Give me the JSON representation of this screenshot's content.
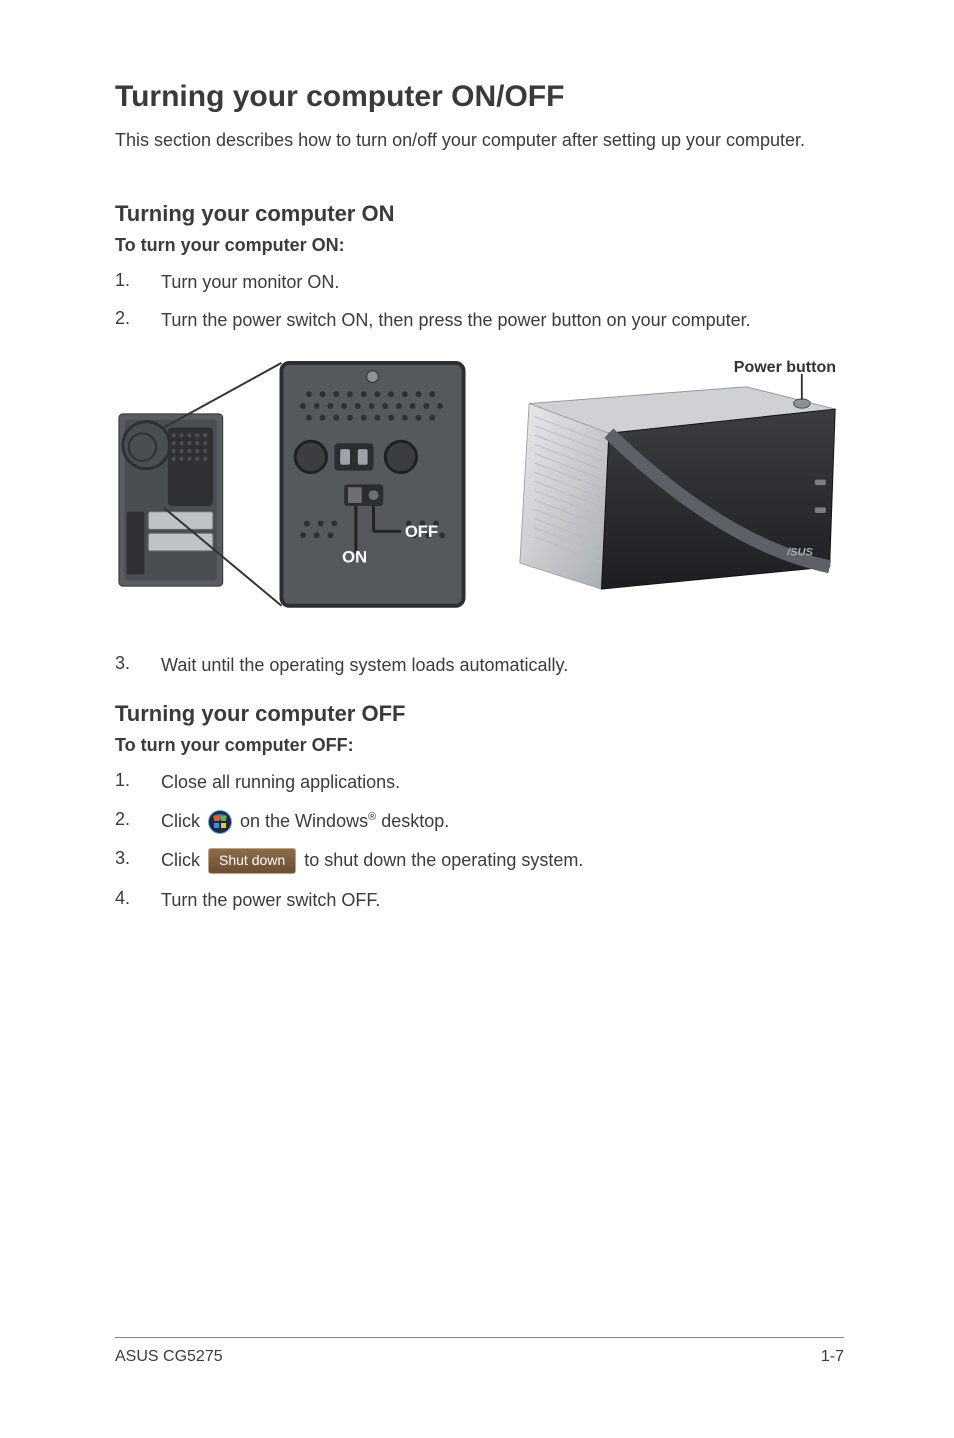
{
  "title": "Turning your computer ON/OFF",
  "intro": "This section describes how to turn on/off your computer after setting up your computer.",
  "on_section": {
    "heading": "Turning your computer ON",
    "instruction": "To turn your computer ON:",
    "steps": [
      "Turn your monitor ON.",
      "Turn the power switch ON, then press the power button on your computer."
    ],
    "step3": "Wait until the operating system loads automatically."
  },
  "off_section": {
    "heading": "Turning your computer OFF",
    "instruction": "To turn your computer OFF:",
    "steps": {
      "s1": "Close all running applications.",
      "s2_a": "Click ",
      "s2_b": " on the Windows",
      "s2_c": " desktop.",
      "s3_a": "Click ",
      "s3_b": " to shut down the operating system.",
      "s4": "Turn the power switch OFF."
    }
  },
  "labels": {
    "power_button": "Power button",
    "on": "ON",
    "off": "OFF",
    "shutdown": "Shut down",
    "reg": "®"
  },
  "footer": {
    "left": "ASUS CG5275",
    "right": "1-7"
  }
}
